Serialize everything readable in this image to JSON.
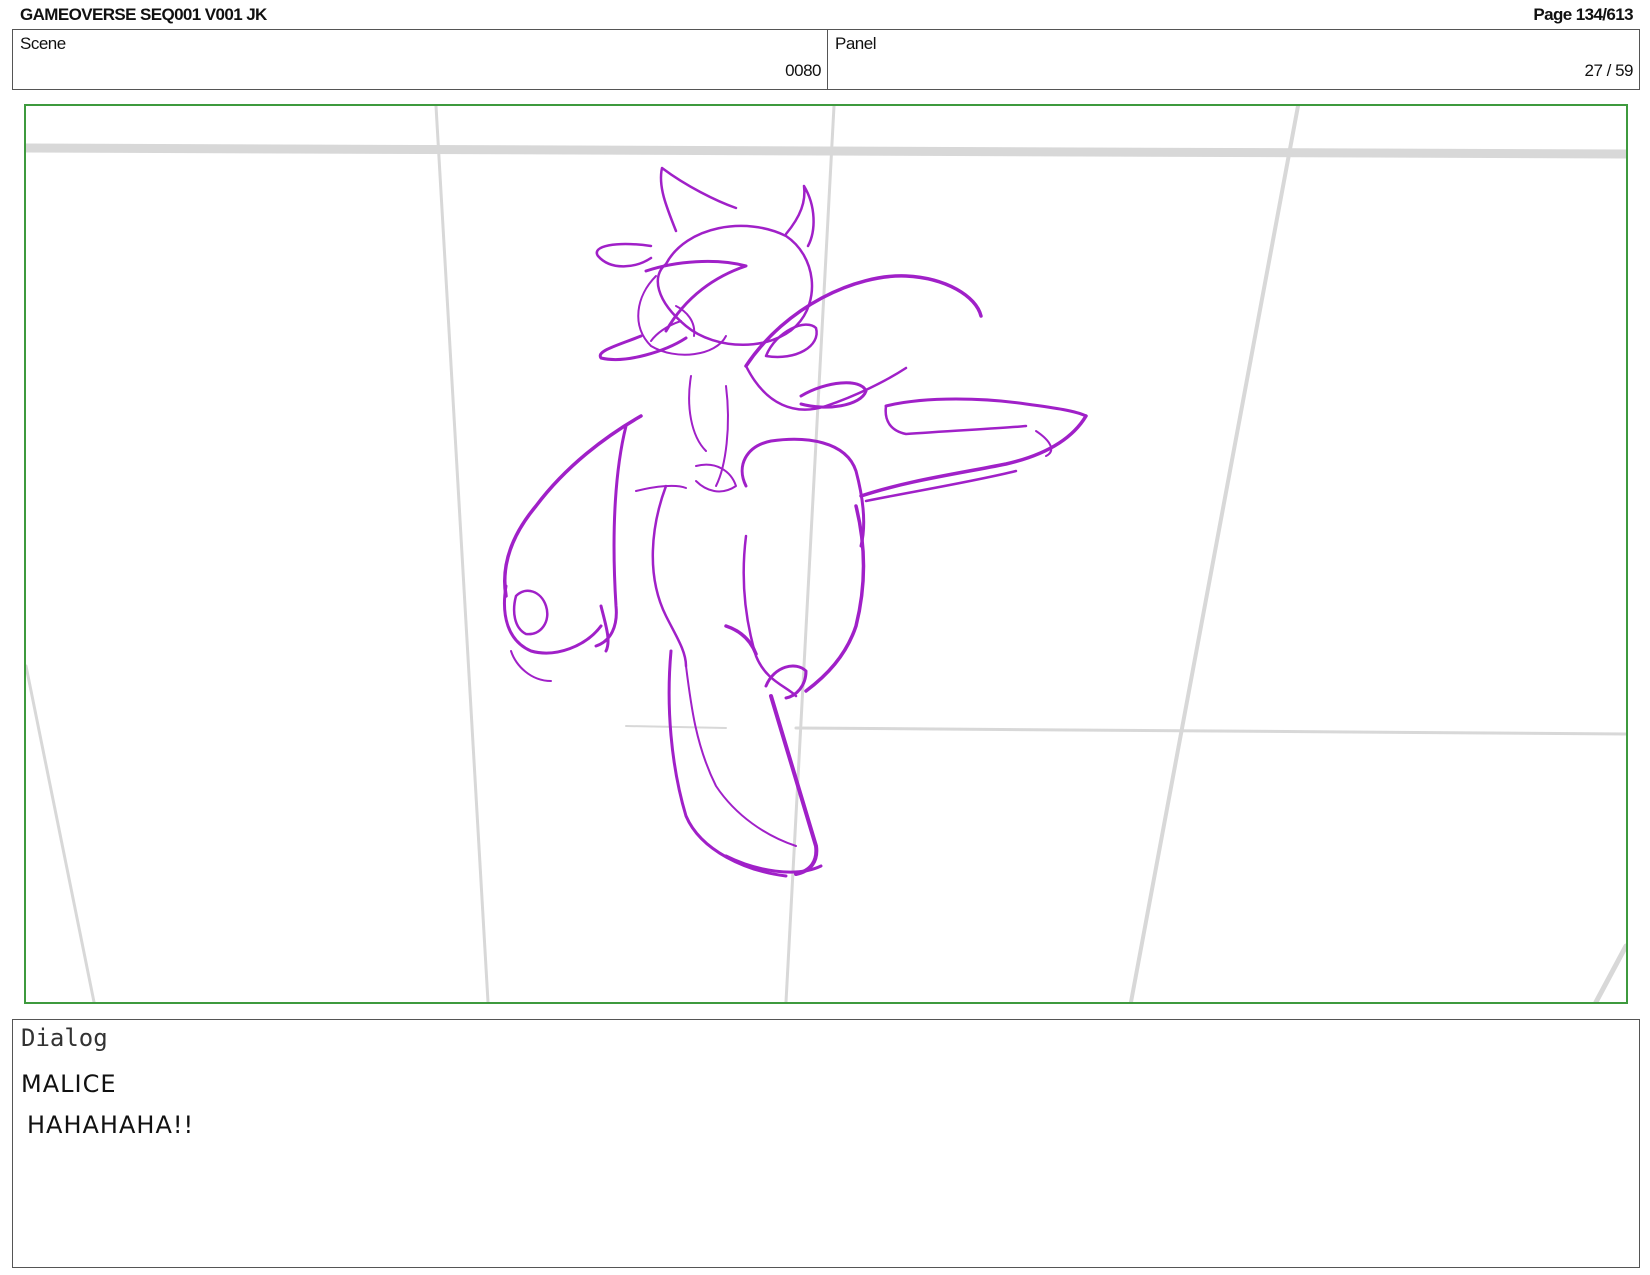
{
  "header": {
    "title": "GAMEOVERSE SEQ001 V001 JK",
    "page": "Page 134/613"
  },
  "scene": {
    "label": "Scene",
    "value": "0080"
  },
  "panel": {
    "label": "Panel",
    "value": "27 / 59"
  },
  "dialog": {
    "label": "Dialog",
    "speaker": "MALICE",
    "line": "HAHAHAHA!!"
  },
  "colors": {
    "sketch": "#a020c8",
    "frame_border": "#3e9a3e",
    "background_lines": "#d6d6d6"
  }
}
